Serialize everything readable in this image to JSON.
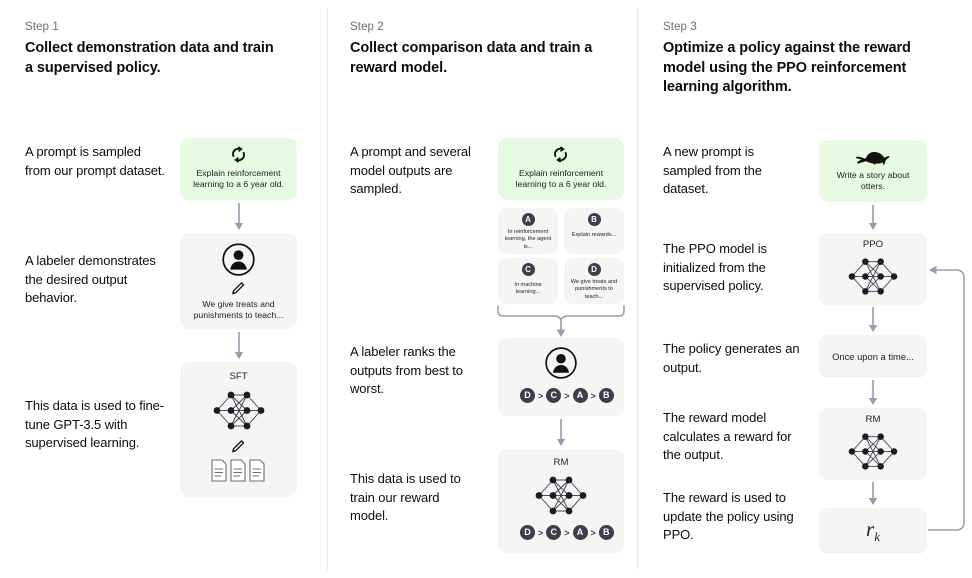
{
  "colors": {
    "green_card": "#e6fbe1",
    "gray_card": "#f5f5f3",
    "pill": "#3d3d4e",
    "arrow": "#9a9ab0",
    "divider": "#e8e8ea",
    "text": "#0d0d0d",
    "muted_text": "#6e6e76"
  },
  "steps": [
    {
      "label": "Step 1",
      "title": "Collect demonstration data and train a supervised policy.",
      "captions": [
        "A prompt is sampled from our prompt dataset.",
        "A labeler demonstrates the desired output behavior.",
        "This data is used to fine-tune GPT-3.5 with supervised learning."
      ],
      "cards": [
        {
          "icon": "sync-icon",
          "text": "Explain reinforcement learning to a 6 year old."
        },
        {
          "icon": "labeler-person-icon",
          "text": "We give treats and punishments to teach..."
        },
        {
          "title": "SFT",
          "icon": "neural-network-icon"
        }
      ]
    },
    {
      "label": "Step 2",
      "title": "Collect comparison data and train a reward model.",
      "captions": [
        "A prompt and several model outputs are sampled.",
        "A labeler ranks the outputs from best to worst.",
        "This data is used to train our reward model."
      ],
      "prompt_card": {
        "icon": "sync-icon",
        "text": "Explain reinforcement learning to a 6 year old."
      },
      "outputs": [
        {
          "letter": "A",
          "text": "In reinforcement learning, the agent is..."
        },
        {
          "letter": "B",
          "text": "Explain rewards..."
        },
        {
          "letter": "C",
          "text": "In machine learning..."
        },
        {
          "letter": "D",
          "text": "We give treats and punishments to teach..."
        }
      ],
      "ranking": [
        "D",
        "C",
        "A",
        "B"
      ],
      "rank_separator": ">",
      "rm_card": {
        "title": "RM",
        "icon": "neural-network-icon"
      }
    },
    {
      "label": "Step 3",
      "title": "Optimize a policy against the reward model using the PPO reinforcement learning algorithm.",
      "captions": [
        "A new prompt is sampled from the dataset.",
        "The PPO model is initialized from the supervised policy.",
        "The policy generates an output.",
        "The reward model calculates a reward for the output.",
        "The reward is used to update the policy using PPO."
      ],
      "cards": [
        {
          "icon": "otter-icon",
          "text": "Write a story about otters."
        },
        {
          "title": "PPO",
          "icon": "neural-network-icon"
        },
        {
          "text": "Once upon a time..."
        },
        {
          "title": "RM",
          "icon": "neural-network-icon"
        },
        {
          "formula": "r",
          "formula_sub": "k"
        }
      ]
    }
  ]
}
